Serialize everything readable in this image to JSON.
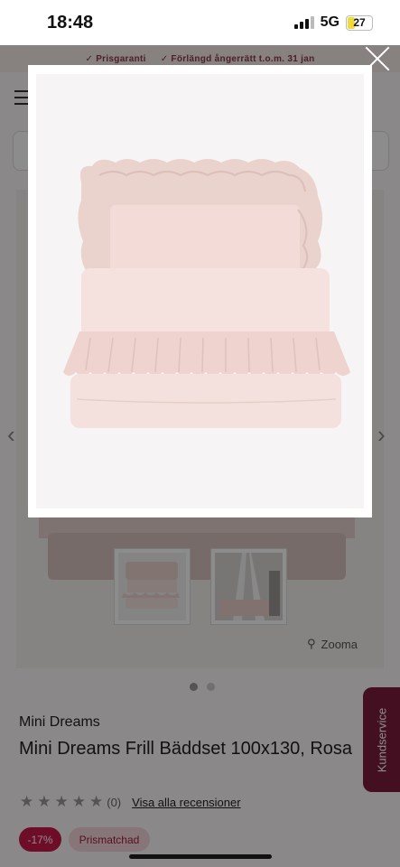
{
  "status_bar": {
    "time": "18:48",
    "network": "5G",
    "battery": "27",
    "battery_level": 0.27,
    "battery_color": "#f2d93c"
  },
  "promo_bar": {
    "items": [
      {
        "icon": "check-icon",
        "label": "Prisgaranti"
      },
      {
        "icon": "check-icon",
        "label": "Förlängd ångerrätt t.o.m. 31 jan"
      }
    ]
  },
  "gallery": {
    "zoom_label": "Zooma",
    "thumbnails": [
      "bedset-front",
      "bedset-canopy"
    ],
    "active_dot": 0,
    "dot_count": 2
  },
  "product": {
    "brand": "Mini Dreams",
    "title": "Mini Dreams Frill Bäddset 100x130, Rosa",
    "rating": {
      "stars": 0,
      "max": 5,
      "count_text": "(0)",
      "reviews_link": "Visa alla recensioner"
    },
    "badges": {
      "discount": "-17%",
      "price_match": "Prismatchad"
    }
  },
  "customer_service": {
    "label": "Kundservice"
  },
  "modal": {
    "image": "frill-bedset-pink"
  },
  "colors": {
    "accent": "#c9184a",
    "brand_dark": "#7c1d3d",
    "fabric_pink": "#f2dad5"
  }
}
